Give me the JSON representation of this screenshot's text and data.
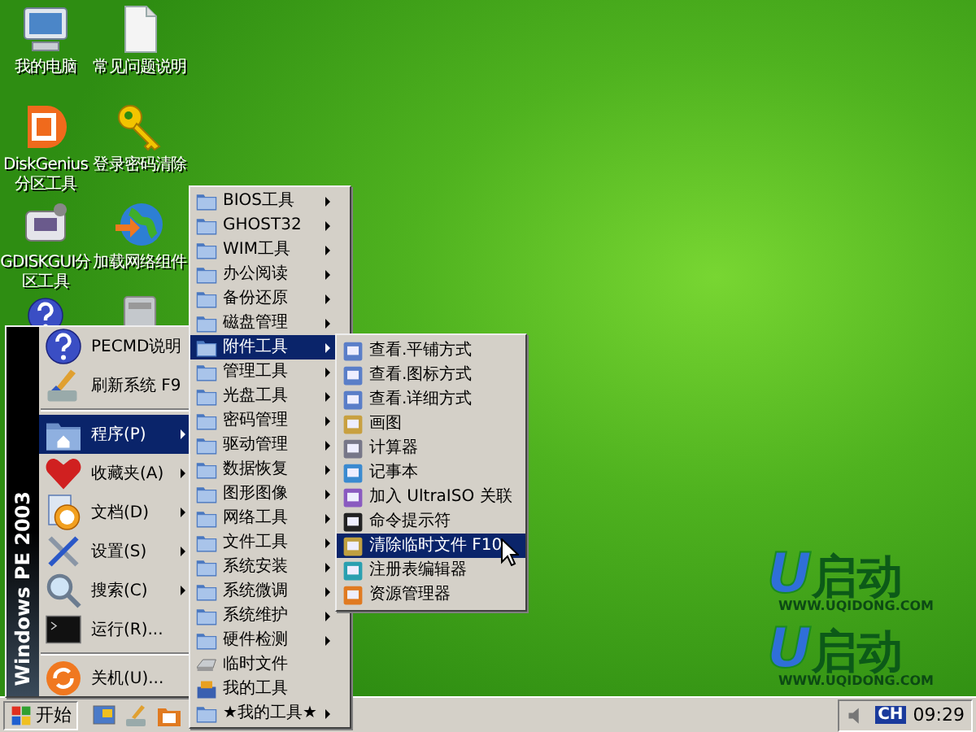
{
  "desktop_icons": [
    {
      "label": "我的电脑"
    },
    {
      "label": "常见问题说明"
    },
    {
      "label": "DiskGenius分区工具"
    },
    {
      "label": "登录密码清除"
    },
    {
      "label": "GDISKGUI分区工具"
    },
    {
      "label": "加载网络组件"
    }
  ],
  "start_menu": {
    "banner": "Windows PE 2003",
    "sections": [
      {
        "items": [
          {
            "label": "PECMD说明",
            "selected": false
          },
          {
            "label": "刷新系统 F9",
            "selected": false
          }
        ]
      },
      {
        "items": [
          {
            "label": "程序(P)",
            "has_submenu": true,
            "selected": true
          },
          {
            "label": "收藏夹(A)",
            "has_submenu": true,
            "selected": false
          },
          {
            "label": "文档(D)",
            "has_submenu": true,
            "selected": false
          },
          {
            "label": "设置(S)",
            "has_submenu": true,
            "selected": false
          },
          {
            "label": "搜索(C)",
            "has_submenu": true,
            "selected": false
          },
          {
            "label": "运行(R)...",
            "has_submenu": false,
            "selected": false
          }
        ]
      },
      {
        "items": [
          {
            "label": "关机(U)...",
            "has_submenu": false,
            "selected": false
          }
        ]
      }
    ]
  },
  "programs_menu": {
    "items": [
      {
        "label": "BIOS工具",
        "kind": "folder",
        "has_submenu": true,
        "selected": false
      },
      {
        "label": "GHOST32",
        "kind": "folder",
        "has_submenu": true,
        "selected": false
      },
      {
        "label": "WIM工具",
        "kind": "folder",
        "has_submenu": true,
        "selected": false
      },
      {
        "label": "办公阅读",
        "kind": "folder",
        "has_submenu": true,
        "selected": false
      },
      {
        "label": "备份还原",
        "kind": "folder",
        "has_submenu": true,
        "selected": false
      },
      {
        "label": "磁盘管理",
        "kind": "folder",
        "has_submenu": true,
        "selected": false
      },
      {
        "label": "附件工具",
        "kind": "folder",
        "has_submenu": true,
        "selected": true
      },
      {
        "label": "管理工具",
        "kind": "folder",
        "has_submenu": true,
        "selected": false
      },
      {
        "label": "光盘工具",
        "kind": "folder",
        "has_submenu": true,
        "selected": false
      },
      {
        "label": "密码管理",
        "kind": "folder",
        "has_submenu": true,
        "selected": false
      },
      {
        "label": "驱动管理",
        "kind": "folder",
        "has_submenu": true,
        "selected": false
      },
      {
        "label": "数据恢复",
        "kind": "folder",
        "has_submenu": true,
        "selected": false
      },
      {
        "label": "图形图像",
        "kind": "folder",
        "has_submenu": true,
        "selected": false
      },
      {
        "label": "网络工具",
        "kind": "folder",
        "has_submenu": true,
        "selected": false
      },
      {
        "label": "文件工具",
        "kind": "folder",
        "has_submenu": true,
        "selected": false
      },
      {
        "label": "系统安装",
        "kind": "folder",
        "has_submenu": true,
        "selected": false
      },
      {
        "label": "系统微调",
        "kind": "folder",
        "has_submenu": true,
        "selected": false
      },
      {
        "label": "系统维护",
        "kind": "folder",
        "has_submenu": true,
        "selected": false
      },
      {
        "label": "硬件检测",
        "kind": "folder",
        "has_submenu": true,
        "selected": false
      },
      {
        "label": "临时文件",
        "kind": "drive",
        "has_submenu": false,
        "selected": false
      },
      {
        "label": "我的工具",
        "kind": "toolbox",
        "has_submenu": false,
        "selected": false
      },
      {
        "label": "★我的工具★",
        "kind": "folder",
        "has_submenu": true,
        "selected": false
      }
    ]
  },
  "accessories_menu": {
    "items": [
      {
        "label": "查看.平铺方式",
        "selected": false
      },
      {
        "label": "查看.图标方式",
        "selected": false
      },
      {
        "label": "查看.详细方式",
        "selected": false
      },
      {
        "label": "画图",
        "selected": false
      },
      {
        "label": "计算器",
        "selected": false
      },
      {
        "label": "记事本",
        "selected": false
      },
      {
        "label": "加入 UltraISO 关联",
        "selected": false
      },
      {
        "label": "命令提示符",
        "selected": false
      },
      {
        "label": "清除临时文件 F10",
        "selected": true
      },
      {
        "label": "注册表编辑器",
        "selected": false
      },
      {
        "label": "资源管理器",
        "selected": false
      }
    ]
  },
  "wallpaper_logos": [
    {
      "mark": "U",
      "name": "启动",
      "url": "WWW.UQIDONG.COM"
    },
    {
      "mark": "U",
      "name": "启动",
      "url": "WWW.UQIDONG.COM"
    }
  ],
  "taskbar": {
    "start_button": "开始",
    "tray": {
      "language": "CH",
      "clock": "09:29"
    }
  }
}
